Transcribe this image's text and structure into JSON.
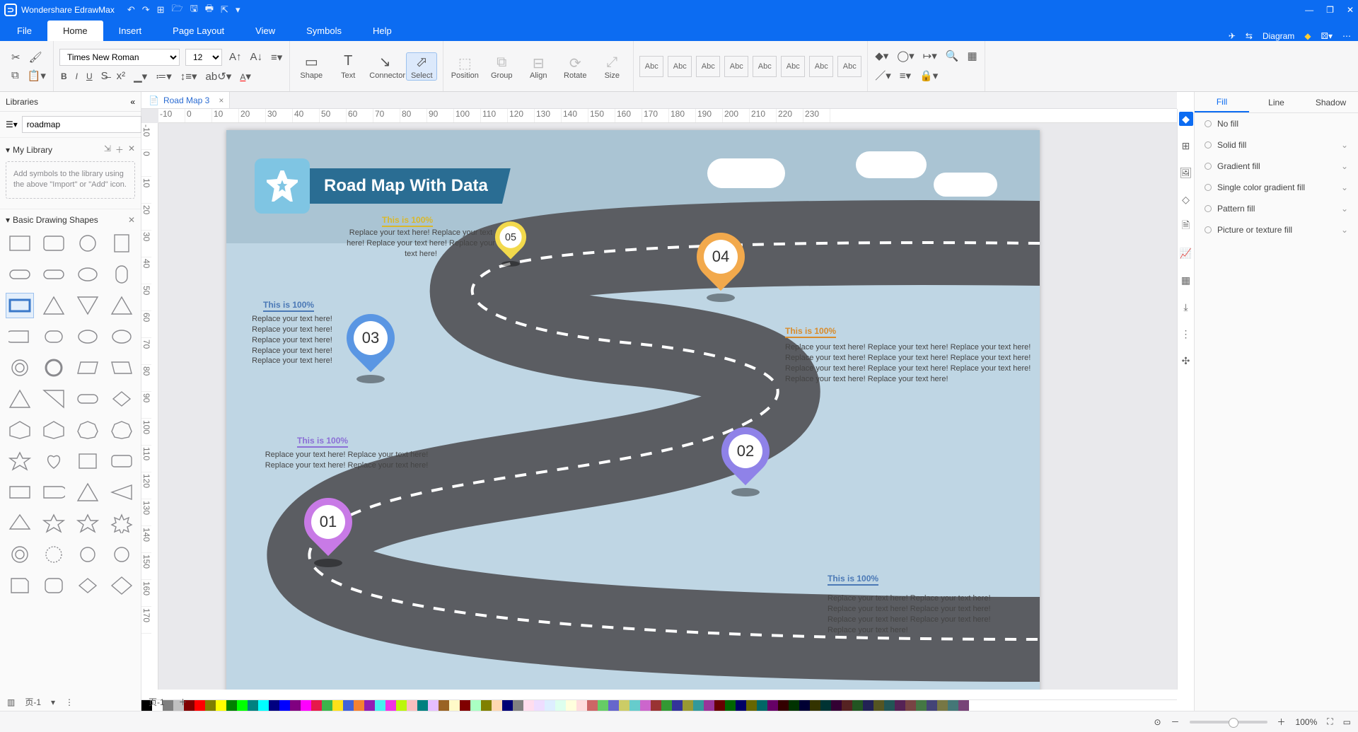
{
  "app": {
    "name": "Wondershare EdrawMax"
  },
  "menus": [
    "File",
    "Home",
    "Insert",
    "Page Layout",
    "View",
    "Symbols",
    "Help"
  ],
  "activeMenu": 1,
  "menuRight": {
    "diagram": "Diagram"
  },
  "font": {
    "family": "Times New Roman",
    "size": "12"
  },
  "toolGroups": {
    "shape": "Shape",
    "text": "Text",
    "connector": "Connector",
    "select": "Select",
    "position": "Position",
    "group": "Group",
    "align": "Align",
    "rotate": "Rotate",
    "size": "Size"
  },
  "styleBoxLabel": "Abc",
  "leftPanel": {
    "title": "Libraries",
    "searchPlaceholder": "",
    "searchValue": "roadmap",
    "myLibrary": "My Library",
    "importHint": "Add symbols to the library using the above \"Import\" or \"Add\" icon.",
    "basicShapes": "Basic Drawing Shapes"
  },
  "docTab": {
    "name": "Road Map 3"
  },
  "rulerH": [
    "-10",
    "0",
    "10",
    "20",
    "30",
    "40",
    "50",
    "60",
    "70",
    "80",
    "90",
    "100",
    "110",
    "120",
    "130",
    "140",
    "150",
    "160",
    "170",
    "180",
    "190",
    "200",
    "210",
    "220",
    "230"
  ],
  "rulerV": [
    "-10",
    "0",
    "10",
    "20",
    "30",
    "40",
    "50",
    "60",
    "70",
    "80",
    "90",
    "100",
    "110",
    "120",
    "130",
    "140",
    "150",
    "160",
    "170"
  ],
  "canvas": {
    "title": "Road Map With Data",
    "milestones": [
      {
        "num": "01",
        "color": "#c87ae6",
        "heading": "This is 100%",
        "headColor": "#8b6fd6",
        "text": "Replace your text here! Replace your text here! Replace your text here!  Replace your text here!"
      },
      {
        "num": "02",
        "color": "#8f82e8",
        "heading": "This is 100%",
        "headColor": "#4b79b6",
        "text": "Replace your text here! Replace your text here! Replace your text here!  Replace your text here! Replace your text here!  Replace your text here! Replace your text here!"
      },
      {
        "num": "03",
        "color": "#5a96e3",
        "heading": "This is 100%",
        "headColor": "#4b79b6",
        "text": "Replace your text here! Replace your text here! Replace your text here! Replace your text here! Replace your text here!"
      },
      {
        "num": "04",
        "color": "#f2a94c",
        "heading": "This is 100%",
        "headColor": "#d98c2b",
        "text": "Replace your text here! Replace your text here! Replace your text here!  Replace your text here! Replace your text here! Replace your text here! Replace your text here!  Replace your text here! Replace your text here!  Replace your text here! Replace your text here!"
      },
      {
        "num": "05",
        "color": "#f2d94c",
        "heading": "This is 100%",
        "headColor": "#d9b82b",
        "text": "Replace your text here! Replace your text here! Replace your text here!  Replace your text here!"
      }
    ]
  },
  "rightPanel": {
    "tabs": [
      "Fill",
      "Line",
      "Shadow"
    ],
    "activeTab": 0,
    "fillOptions": [
      "No fill",
      "Solid fill",
      "Gradient fill",
      "Single color gradient fill",
      "Pattern fill",
      "Picture or texture fill"
    ]
  },
  "status": {
    "page": "页-1",
    "pageTab": "页-1",
    "zoom": "100%"
  },
  "colorStrip": [
    "#000",
    "#fff",
    "#7f7f7f",
    "#c0c0c0",
    "#800000",
    "#f00",
    "#808000",
    "#ff0",
    "#008000",
    "#0f0",
    "#008080",
    "#0ff",
    "#000080",
    "#00f",
    "#800080",
    "#f0f",
    "#e6194b",
    "#3cb44b",
    "#ffe119",
    "#4363d8",
    "#f58231",
    "#911eb4",
    "#46f0f0",
    "#f032e6",
    "#bcf60c",
    "#fabebe",
    "#008080",
    "#e6beff",
    "#9a6324",
    "#fffac8",
    "#800000",
    "#aaffc3",
    "#808000",
    "#ffd8b1",
    "#000075",
    "#808080",
    "#fde",
    "#edf",
    "#def",
    "#dfe",
    "#ffd",
    "#fdd",
    "#c66",
    "#6c6",
    "#66c",
    "#cc6",
    "#6cc",
    "#c6c",
    "#933",
    "#393",
    "#339",
    "#993",
    "#399",
    "#939",
    "#600",
    "#060",
    "#006",
    "#660",
    "#066",
    "#606",
    "#300",
    "#030",
    "#003",
    "#330",
    "#033",
    "#303",
    "#522",
    "#252",
    "#225",
    "#552",
    "#255",
    "#525",
    "#744",
    "#474",
    "#447",
    "#774",
    "#477",
    "#747"
  ]
}
